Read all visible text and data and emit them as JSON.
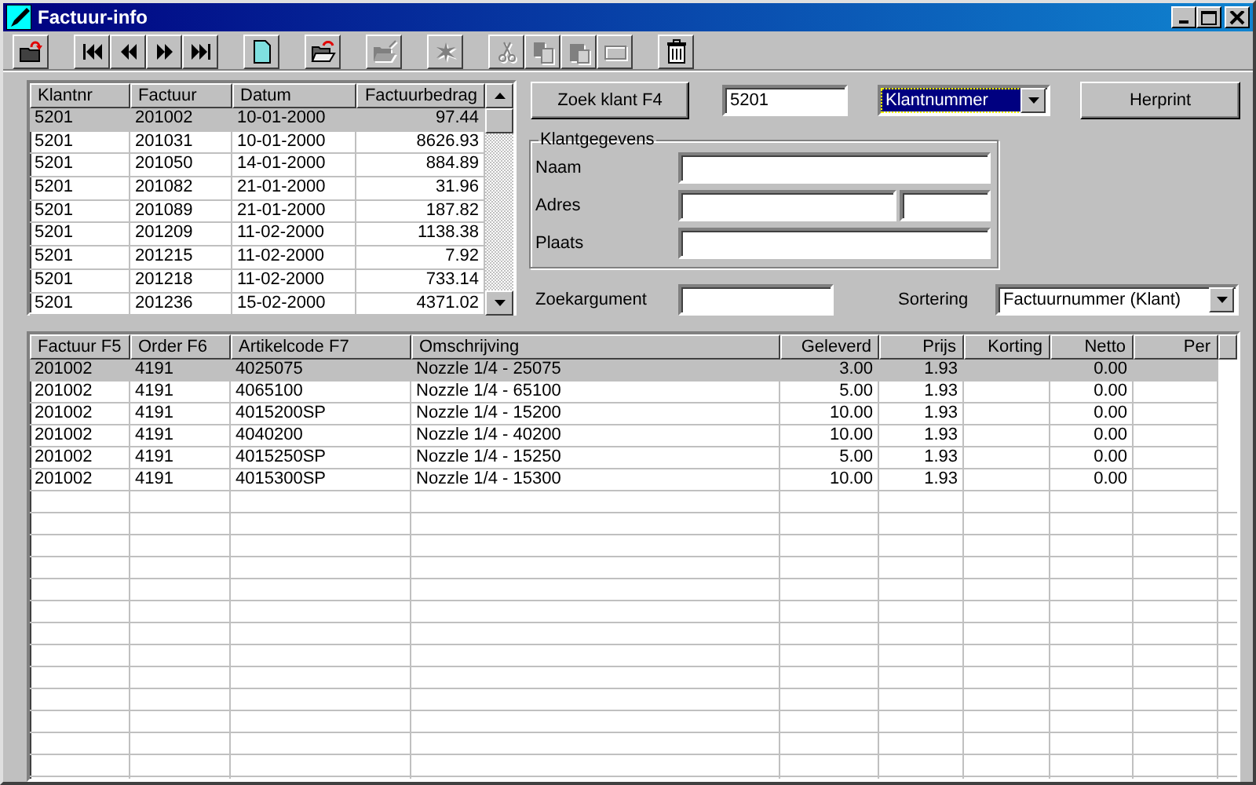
{
  "window": {
    "title": "Factuur-info"
  },
  "toolbar": [
    [
      {
        "kind": "exit",
        "disabled": false
      }
    ],
    [
      {
        "kind": "first",
        "disabled": false
      },
      {
        "kind": "prev",
        "disabled": false
      },
      {
        "kind": "next",
        "disabled": false
      },
      {
        "kind": "last",
        "disabled": false
      }
    ],
    [
      {
        "kind": "new",
        "disabled": false
      }
    ],
    [
      {
        "kind": "open",
        "disabled": false
      }
    ],
    [
      {
        "kind": "folder",
        "disabled": true
      }
    ],
    [
      {
        "kind": "splat",
        "disabled": true
      }
    ],
    [
      {
        "kind": "cut",
        "disabled": true
      },
      {
        "kind": "copy",
        "disabled": true
      },
      {
        "kind": "paste",
        "disabled": true
      },
      {
        "kind": "frame",
        "disabled": true
      }
    ],
    [
      {
        "kind": "trash",
        "disabled": false
      }
    ]
  ],
  "invoices": {
    "columns": [
      {
        "label": "Klantnr",
        "kind": "text"
      },
      {
        "label": "Factuur",
        "kind": "text"
      },
      {
        "label": "Datum",
        "kind": "text"
      },
      {
        "label": "Factuurbedrag",
        "kind": "number"
      }
    ],
    "rows": [
      {
        "cells": [
          "5201",
          "201002",
          "10-01-2000",
          "97.44"
        ],
        "selected": true
      },
      {
        "cells": [
          "5201",
          "201031",
          "10-01-2000",
          "8626.93"
        ],
        "selected": false
      },
      {
        "cells": [
          "5201",
          "201050",
          "14-01-2000",
          "884.89"
        ],
        "selected": false
      },
      {
        "cells": [
          "5201",
          "201082",
          "21-01-2000",
          "31.96"
        ],
        "selected": false
      },
      {
        "cells": [
          "5201",
          "201089",
          "21-01-2000",
          "187.82"
        ],
        "selected": false
      },
      {
        "cells": [
          "5201",
          "201209",
          "11-02-2000",
          "1138.38"
        ],
        "selected": false
      },
      {
        "cells": [
          "5201",
          "201215",
          "11-02-2000",
          "7.92"
        ],
        "selected": false
      },
      {
        "cells": [
          "5201",
          "201218",
          "11-02-2000",
          "733.14"
        ],
        "selected": false
      },
      {
        "cells": [
          "5201",
          "201236",
          "15-02-2000",
          "4371.02"
        ],
        "selected": false
      }
    ]
  },
  "search": {
    "button": "Zoek klant F4",
    "value": "5201",
    "mode": "Klantnummer",
    "reprint": "Herprint"
  },
  "customer": {
    "legend": "Klantgegevens",
    "fields": [
      {
        "label": "Naam",
        "kind": "single"
      },
      {
        "label": "Adres",
        "kind": "split"
      },
      {
        "label": "Plaats",
        "kind": "single"
      }
    ]
  },
  "filter": {
    "label": "Zoekargument",
    "sort_label": "Sortering",
    "sort_value": "Factuurnummer (Klant)"
  },
  "lines": {
    "columns": [
      {
        "label": "Factuur F5",
        "kind": "text"
      },
      {
        "label": "Order F6",
        "kind": "text"
      },
      {
        "label": "Artikelcode F7",
        "kind": "text"
      },
      {
        "label": "Omschrijving",
        "kind": "text"
      },
      {
        "label": "Geleverd",
        "kind": "number"
      },
      {
        "label": "Prijs",
        "kind": "number"
      },
      {
        "label": "Korting",
        "kind": "number"
      },
      {
        "label": "Netto",
        "kind": "number"
      },
      {
        "label": "Per",
        "kind": "number"
      }
    ],
    "rows": [
      {
        "cells": [
          "201002",
          "4191",
          "4025075",
          "Nozzle 1/4 - 25075",
          "3.00",
          "1.93",
          "",
          "0.00",
          ""
        ],
        "selected": true
      },
      {
        "cells": [
          "201002",
          "4191",
          "4065100",
          "Nozzle 1/4 - 65100",
          "5.00",
          "1.93",
          "",
          "0.00",
          ""
        ],
        "selected": false
      },
      {
        "cells": [
          "201002",
          "4191",
          "4015200SP",
          "Nozzle 1/4 - 15200",
          "10.00",
          "1.93",
          "",
          "0.00",
          ""
        ],
        "selected": false
      },
      {
        "cells": [
          "201002",
          "4191",
          "4040200",
          "Nozzle 1/4 - 40200",
          "10.00",
          "1.93",
          "",
          "0.00",
          ""
        ],
        "selected": false
      },
      {
        "cells": [
          "201002",
          "4191",
          "4015250SP",
          "Nozzle 1/4 - 15250",
          "5.00",
          "1.93",
          "",
          "0.00",
          ""
        ],
        "selected": false
      },
      {
        "cells": [
          "201002",
          "4191",
          "4015300SP",
          "Nozzle 1/4 - 15300",
          "10.00",
          "1.93",
          "",
          "0.00",
          ""
        ],
        "selected": false
      }
    ]
  }
}
